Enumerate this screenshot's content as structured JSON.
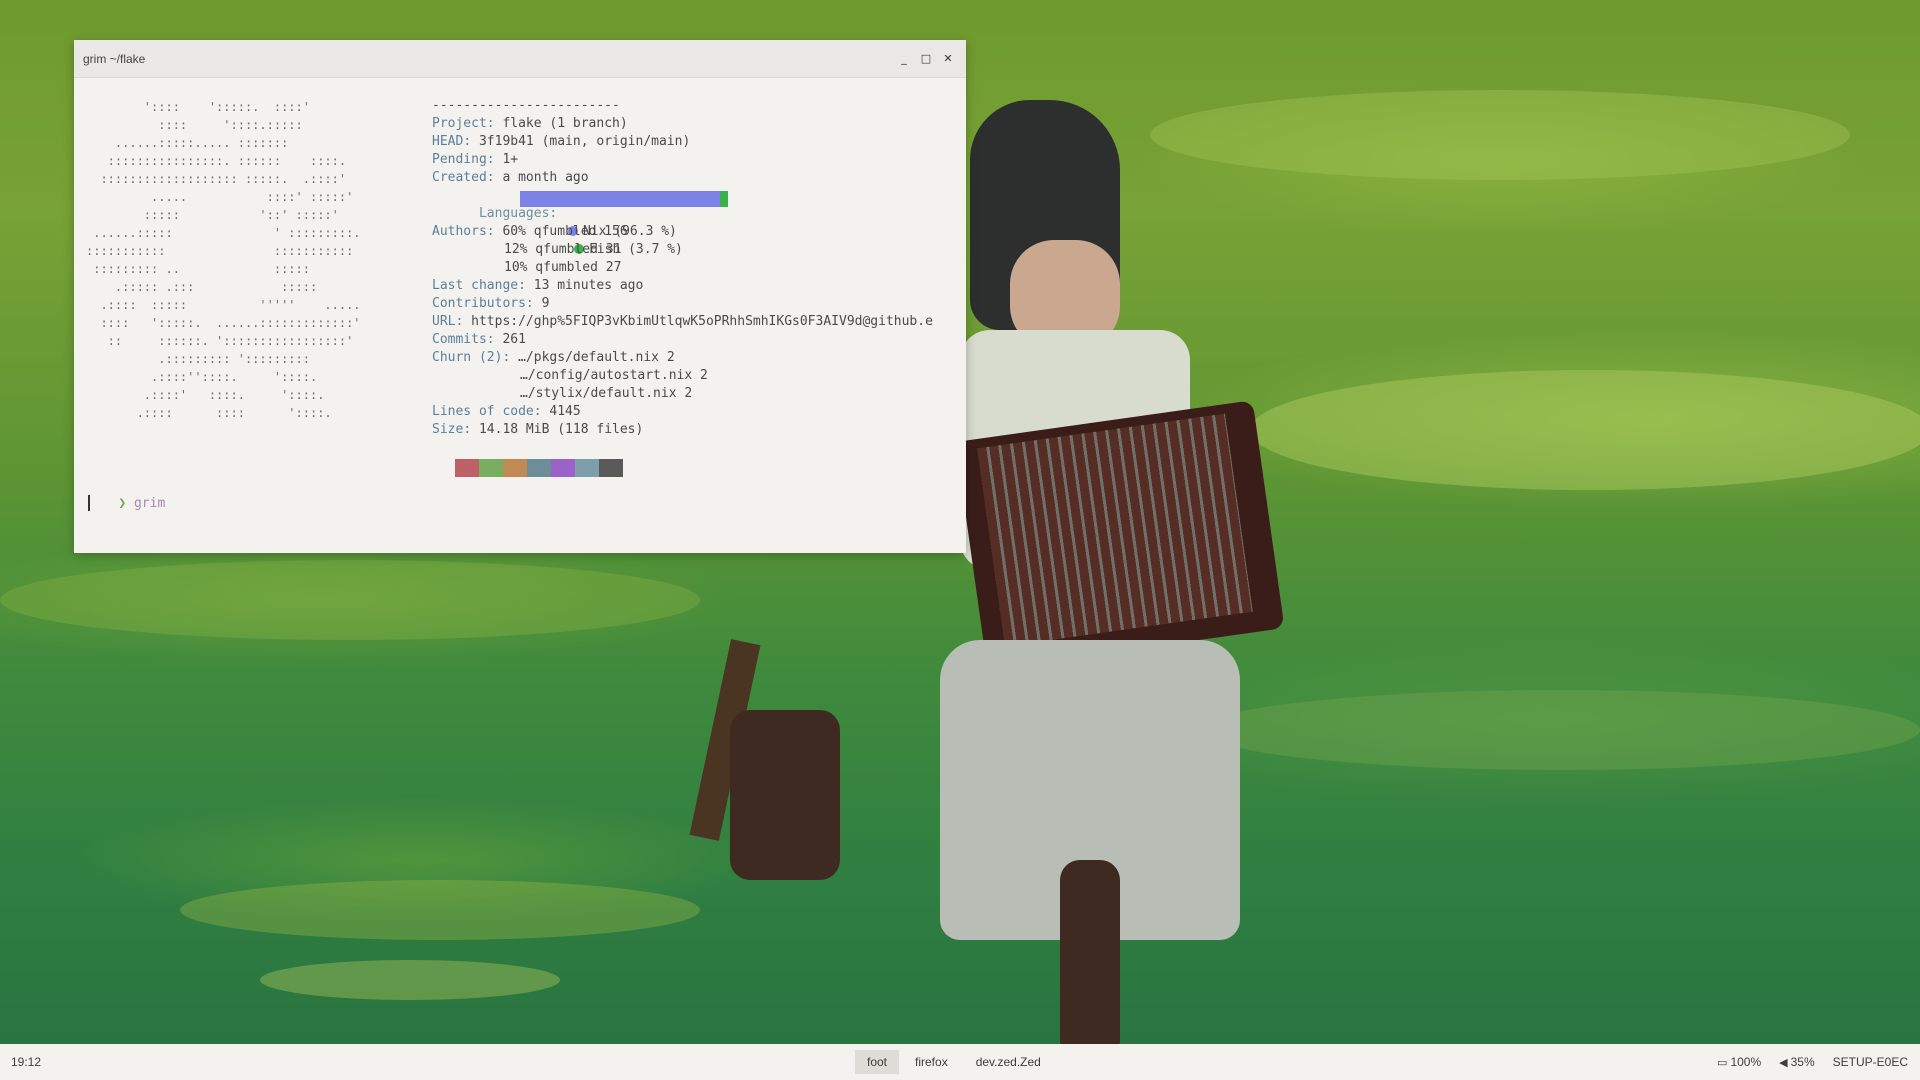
{
  "window": {
    "title": "grim ~/flake",
    "controls": {
      "minimize": "_",
      "maximize": "□",
      "close": "✕"
    }
  },
  "terminal": {
    "ascii_art": "        '::::    ':::::.  ::::'\n          ::::     '::::.:::::\n    ......:::::..... :::::::\n   ::::::::::::::::. ::::::    ::::.\n  ::::::::::::::::::: :::::.  .::::'\n         .....           ::::' :::::'\n        :::::           '::' :::::'\n ......:::::              ' :::::::::.\n:::::::::::               :::::::::::\n ::::::::: ..             :::::\n    .::::: .:::            :::::\n  .::::  :::::          '''''    .....\n  ::::   ':::::.  ......:::::::::::::'\n   ::     ::::::. ':::::::::::::::::'\n          .::::::::: ':::::::::\n         .::::''::::.     '::::.\n        .::::'   ::::.     '::::.\n       .::::      ::::      '::::.",
    "separator": "------------------------",
    "rows": [
      {
        "key": "Project",
        "value": " flake (1 branch)"
      },
      {
        "key": "HEAD",
        "value": " 3f19b41 (main, origin/main)"
      },
      {
        "key": "Pending",
        "value": " 1+"
      },
      {
        "key": "Created",
        "value": " a month ago"
      }
    ],
    "languages_label": "Languages",
    "languages": {
      "nix": {
        "label": "Nix (96.3 %)",
        "pct": 96.3,
        "color": "#7b83e6"
      },
      "fish": {
        "label": "Fish (3.7 %)",
        "pct": 3.7,
        "color": "#3cb04b"
      }
    },
    "authors_label": "Authors",
    "authors": [
      "60% qfumbled 156",
      "12% qfumbled 31",
      "10% qfumbled 27"
    ],
    "rows2": [
      {
        "key": "Last change",
        "value": " 13 minutes ago"
      },
      {
        "key": "Contributors",
        "value": " 9"
      },
      {
        "key": "URL",
        "value": " https://ghp%5FIQP3vKbimUtlqwK5oPRhhSmhIKGs0F3AIV9d@github.e"
      },
      {
        "key": "Commits",
        "value": " 261"
      }
    ],
    "churn_label": "Churn (2)",
    "churn": [
      "…/pkgs/default.nix 2",
      "…/config/autostart.nix 2",
      "…/stylix/default.nix 2"
    ],
    "rows3": [
      {
        "key": "Lines of code",
        "value": " 4145"
      },
      {
        "key": "Size",
        "value": " 14.18 MiB (118 files)"
      }
    ],
    "palette": [
      "#bd6068",
      "#79ae60",
      "#c08a55",
      "#6b8e98",
      "#9b62c9",
      "#7d9fac",
      "#5a5a5a"
    ],
    "prompt_symbol": "❯",
    "prompt_command": "grim"
  },
  "taskbar": {
    "clock": "19:12",
    "tasks": [
      "foot",
      "firefox",
      "dev.zed.Zed"
    ],
    "active_task": "foot",
    "battery": "100%",
    "volume": "35%",
    "hostname": "SETUP-E0EC"
  }
}
